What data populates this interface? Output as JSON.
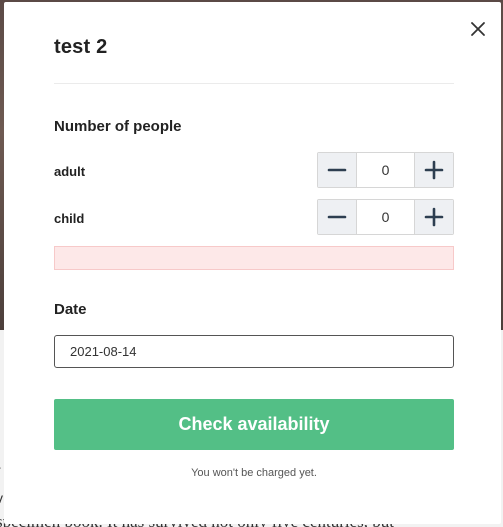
{
  "background": {
    "text": "specimen book. It has survived not only five centuries, but",
    "stray_chars": [
      "r",
      "v"
    ]
  },
  "modal": {
    "title": "test 2",
    "close_icon": "close-icon",
    "people": {
      "heading": "Number of people",
      "rows": [
        {
          "label": "adult",
          "value": "0"
        },
        {
          "label": "child",
          "value": "0"
        }
      ]
    },
    "date": {
      "heading": "Date",
      "value": "2021-08-14"
    },
    "check_button_label": "Check availability",
    "note": "You won't be charged yet."
  },
  "colors": {
    "accent": "#53bf86",
    "error_bg": "#fde8e8",
    "stepper_bg": "#eef0f3"
  }
}
